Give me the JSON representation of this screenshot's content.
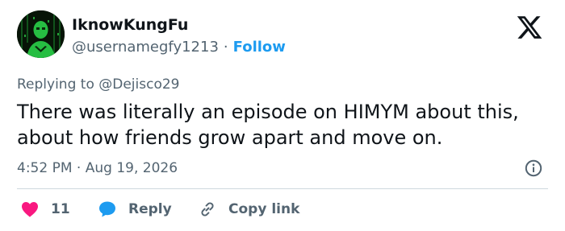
{
  "author": {
    "display_name": "IknowKungFu",
    "handle": "@usernamegfy1213",
    "separator": "·",
    "follow_label": "Follow"
  },
  "reply_context": {
    "prefix": "Replying to",
    "mention": "@Dejisco29"
  },
  "tweet": {
    "text": "There was literally an episode on HIMYM about this, about how friends grow apart and move on."
  },
  "meta": {
    "time": "4:52 PM",
    "separator": "·",
    "date": "Aug 19, 2026"
  },
  "actions": {
    "like_count": "11",
    "reply_label": "Reply",
    "copy_label": "Copy link"
  },
  "colors": {
    "accent": "#1d9bf0",
    "like": "#f91880",
    "reply_icon": "#1d9bf0",
    "muted": "#536471",
    "text": "#0f1419",
    "divider": "#cfd9de"
  },
  "icons": {
    "platform": "x-logo-icon",
    "info": "info-icon",
    "like": "heart-icon",
    "reply": "speech-bubble-icon",
    "copy": "link-icon"
  }
}
